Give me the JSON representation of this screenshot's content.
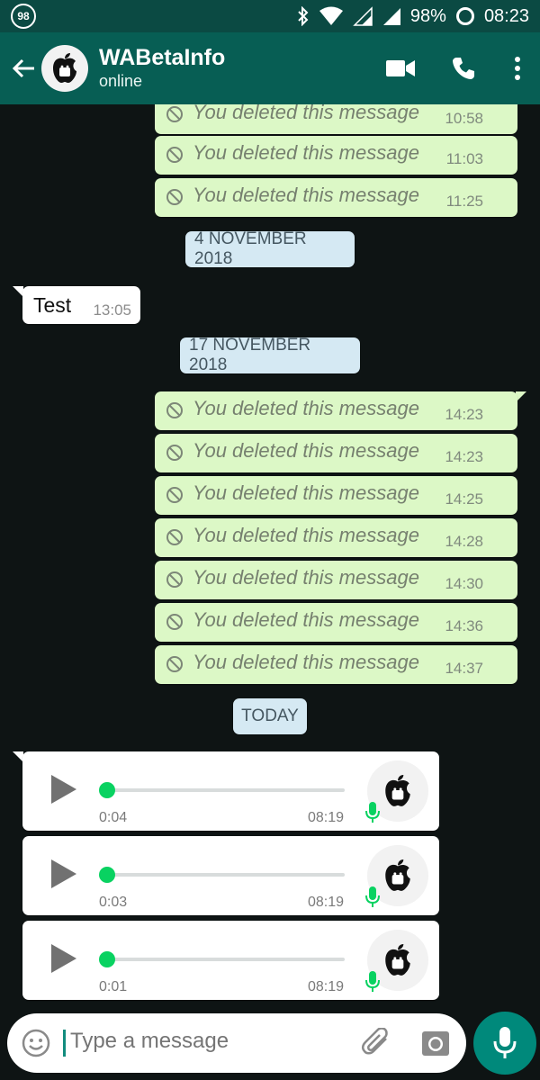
{
  "status_bar": {
    "notification_count": "98",
    "battery": "98%",
    "time": "08:23"
  },
  "header": {
    "title": "WABetaInfo",
    "subtitle": "online",
    "icons": [
      "back-arrow-icon",
      "video-call-icon",
      "phone-icon",
      "overflow-menu-icon"
    ]
  },
  "messages": {
    "deleted_text": "You deleted this message",
    "outgoing_top": [
      {
        "time": "10:58"
      },
      {
        "time": "11:03"
      },
      {
        "time": "11:25"
      }
    ],
    "date_1": "4 NOVEMBER 2018",
    "incoming_text": {
      "text": "Test",
      "time": "13:05"
    },
    "date_2": "17 NOVEMBER 2018",
    "outgoing_bottom": [
      {
        "time": "14:23"
      },
      {
        "time": "14:23"
      },
      {
        "time": "14:25"
      },
      {
        "time": "14:28"
      },
      {
        "time": "14:30"
      },
      {
        "time": "14:36"
      },
      {
        "time": "14:37"
      }
    ],
    "date_3": "TODAY",
    "voice_notes": [
      {
        "duration": "0:04",
        "time": "08:19"
      },
      {
        "duration": "0:03",
        "time": "08:19"
      },
      {
        "duration": "0:01",
        "time": "08:19"
      }
    ]
  },
  "composer": {
    "placeholder": "Type a message"
  },
  "colors": {
    "header": "#075e54",
    "status_bar": "#0b4a43",
    "outgoing_bubble": "#dcf8c6",
    "date_chip": "#d5e9f3",
    "fab": "#00897b",
    "progress_dot": "#09d261"
  }
}
